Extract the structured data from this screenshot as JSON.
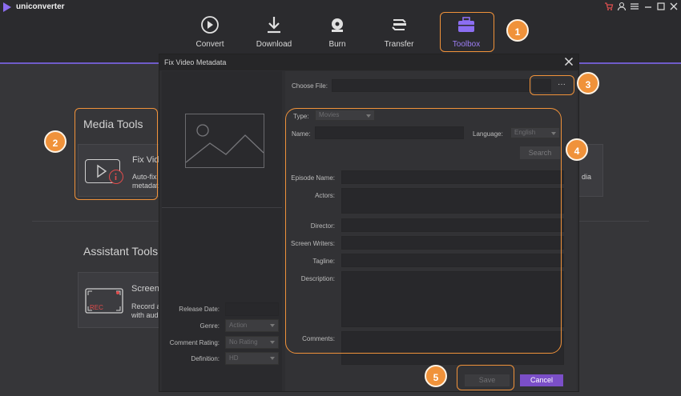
{
  "app": {
    "name": "uniconverter"
  },
  "nav": {
    "items": [
      {
        "label": "Convert"
      },
      {
        "label": "Download"
      },
      {
        "label": "Burn"
      },
      {
        "label": "Transfer"
      },
      {
        "label": "Toolbox"
      }
    ]
  },
  "background": {
    "media_tools_heading": "Media Tools",
    "fix_card_title": "Fix Vid",
    "fix_card_desc_1": "Auto-fix",
    "fix_card_desc_2": "metadat",
    "right_card_text": "dia",
    "assistant_tools_heading": "Assistant Tools",
    "screen_card_title": "Screen",
    "screen_card_desc_1": "Record a",
    "screen_card_desc_2": "with aud",
    "rec_label": "REC"
  },
  "dialog": {
    "title": "Fix Video Metadata",
    "choose_file_label": "Choose File:",
    "browse_label": "···",
    "type_label": "Type:",
    "type_value": "Movies",
    "name_label": "Name:",
    "language_label": "Language:",
    "language_value": "English",
    "search_label": "Search",
    "episode_name_label": "Episode Name:",
    "actors_label": "Actors:",
    "director_label": "Director:",
    "screen_writers_label": "Screen Writers:",
    "tagline_label": "Tagline:",
    "description_label": "Description:",
    "comments_label": "Comments:",
    "release_date_label": "Release Date:",
    "genre_label": "Genre:",
    "genre_value": "Action",
    "comment_rating_label": "Comment Rating:",
    "comment_rating_value": "No Rating",
    "definition_label": "Definition:",
    "definition_value": "HD",
    "save_label": "Save",
    "cancel_label": "Cancel"
  },
  "annotations": {
    "b1": "1",
    "b2": "2",
    "b3": "3",
    "b4": "4",
    "b5": "5"
  },
  "colors": {
    "accent": "#6f5cc9",
    "annotation": "#f0923a",
    "cancel_button": "#7b4fc8"
  }
}
